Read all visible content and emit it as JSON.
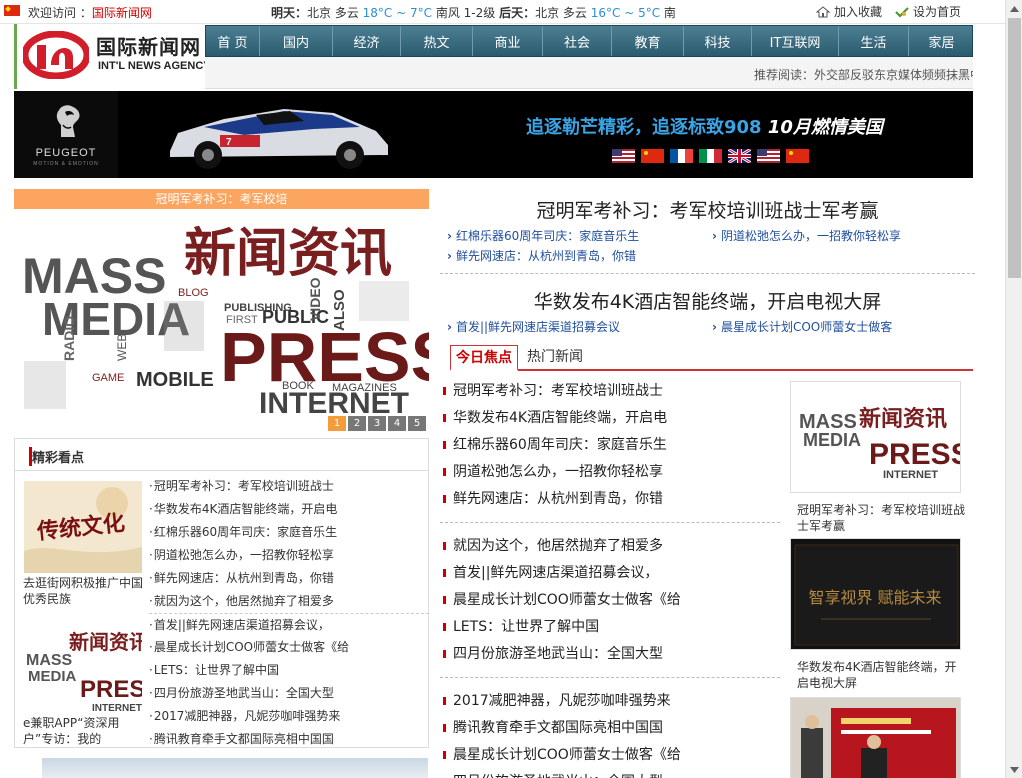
{
  "topbar": {
    "welcome_prefix": "欢迎访问 ：",
    "site_name": "国际新闻网",
    "weather": {
      "today_label": "明天：",
      "today_city": "北京 多云 ",
      "today_temp": "18°C ~ 7°C",
      "today_wind": " 南风 1-2级",
      "next_label": "后天：",
      "next_city": "北京 多云 ",
      "next_temp": "16°C ~ 5°C",
      "next_wind": " 南"
    },
    "favorite_label": "加入收藏",
    "homepage_label": "设为首页"
  },
  "logo": {
    "name_cn": "国际新闻网",
    "name_en": "INT'L NEWS AGENCY"
  },
  "nav": {
    "items": [
      "首 页",
      "国内",
      "经济",
      "热文",
      "商业",
      "社会",
      "教育",
      "科技",
      "IT互联网",
      "生活",
      "家居"
    ]
  },
  "notice": {
    "text": "推荐阅读：外交部反驳东京媒体频频抹黑中"
  },
  "banner": {
    "brand": "PEUGEOT",
    "brand_tag": "MOTION & EMOTION",
    "slogan_main": "追逐勒芒精彩，追逐标致908 ",
    "slogan_date": "10月燃情美国"
  },
  "focus": {
    "caption": "冠明军考补习：考军校培",
    "hero_words": {
      "cn": "新闻资讯",
      "mass": "MASS",
      "media": "MEDIA",
      "press": "PRESS",
      "internet": "INTERNET",
      "mobile": "MOBILE",
      "public": "PUBLIC",
      "blog": "BLOG",
      "publishing": "PUBLISHING",
      "radio": "RADIO",
      "game": "GAME",
      "video": "VIDEO",
      "book": "BOOK",
      "magazines": "MAGAZINES",
      "first": "FIRST",
      "also": "ALSO",
      "web": "WEB"
    },
    "dots": [
      "1",
      "2",
      "3",
      "4",
      "5"
    ]
  },
  "highlights": {
    "title": "精彩看点",
    "image1_text": "传统文化",
    "image1_caption": "去逛街网积极推广中国优秀民族",
    "image2_caption": "e兼职APP“资深用户”专访：我的",
    "list": [
      "冠明军考补习：考军校培训班战士",
      "华数发布4K酒店智能终端，开启电",
      "红棉乐器60周年司庆：家庭音乐生",
      "阴道松弛怎么办，一招教你轻松享",
      "鲜先网速店：从杭州到青岛，你错",
      "就因为这个，他居然抛弃了相爱多",
      "首发||鲜先网速店渠道招募会议，",
      "晨星成长计划COO师蕾女士做客《给",
      "LETS：让世界了解中国",
      "四月份旅游圣地武当山：全国大型",
      "2017减肥神器，凡妮莎咖啡强势来",
      "腾讯教育牵手文都国际亮相中国国"
    ]
  },
  "main": {
    "headline1": "冠明军考补习：考军校培训班战士军考赢",
    "headline1_links": [
      "红棉乐器60周年司庆：家庭音乐生",
      "阴道松弛怎么办，一招教你轻松享",
      "鲜先网速店：从杭州到青岛，你错"
    ],
    "headline2": "华数发布4K酒店智能终端，开启电视大屏",
    "headline2_links": [
      "首发||鲜先网速店渠道招募会议",
      "晨星成长计划COO师蕾女士做客"
    ],
    "tabs": [
      "今日焦点",
      "热门新闻"
    ],
    "list1": [
      "冠明军考补习：考军校培训班战士",
      "华数发布4K酒店智能终端，开启电",
      "红棉乐器60周年司庆：家庭音乐生",
      "阴道松弛怎么办，一招教你轻松享",
      "鲜先网速店：从杭州到青岛，你错"
    ],
    "list2": [
      "就因为这个，他居然抛弃了相爱多",
      "首发||鲜先网速店渠道招募会议，",
      "晨星成长计划COO师蕾女士做客《给",
      "LETS：让世界了解中国",
      "四月份旅游圣地武当山：全国大型"
    ],
    "list3": [
      "2017减肥神器，凡妮莎咖啡强势来",
      "腾讯教育牵手文都国际亮相中国国",
      "晨星成长计划COO师蕾女士做客《给",
      "四月份旅游圣地武当山：全国大型"
    ]
  },
  "side": {
    "caption1": "冠明军考补习：考军校培训班战士军考赢",
    "caption2": "华数发布4K酒店智能终端，开启电视大屏",
    "thumb2_text": "智享视界 赋能未来"
  }
}
